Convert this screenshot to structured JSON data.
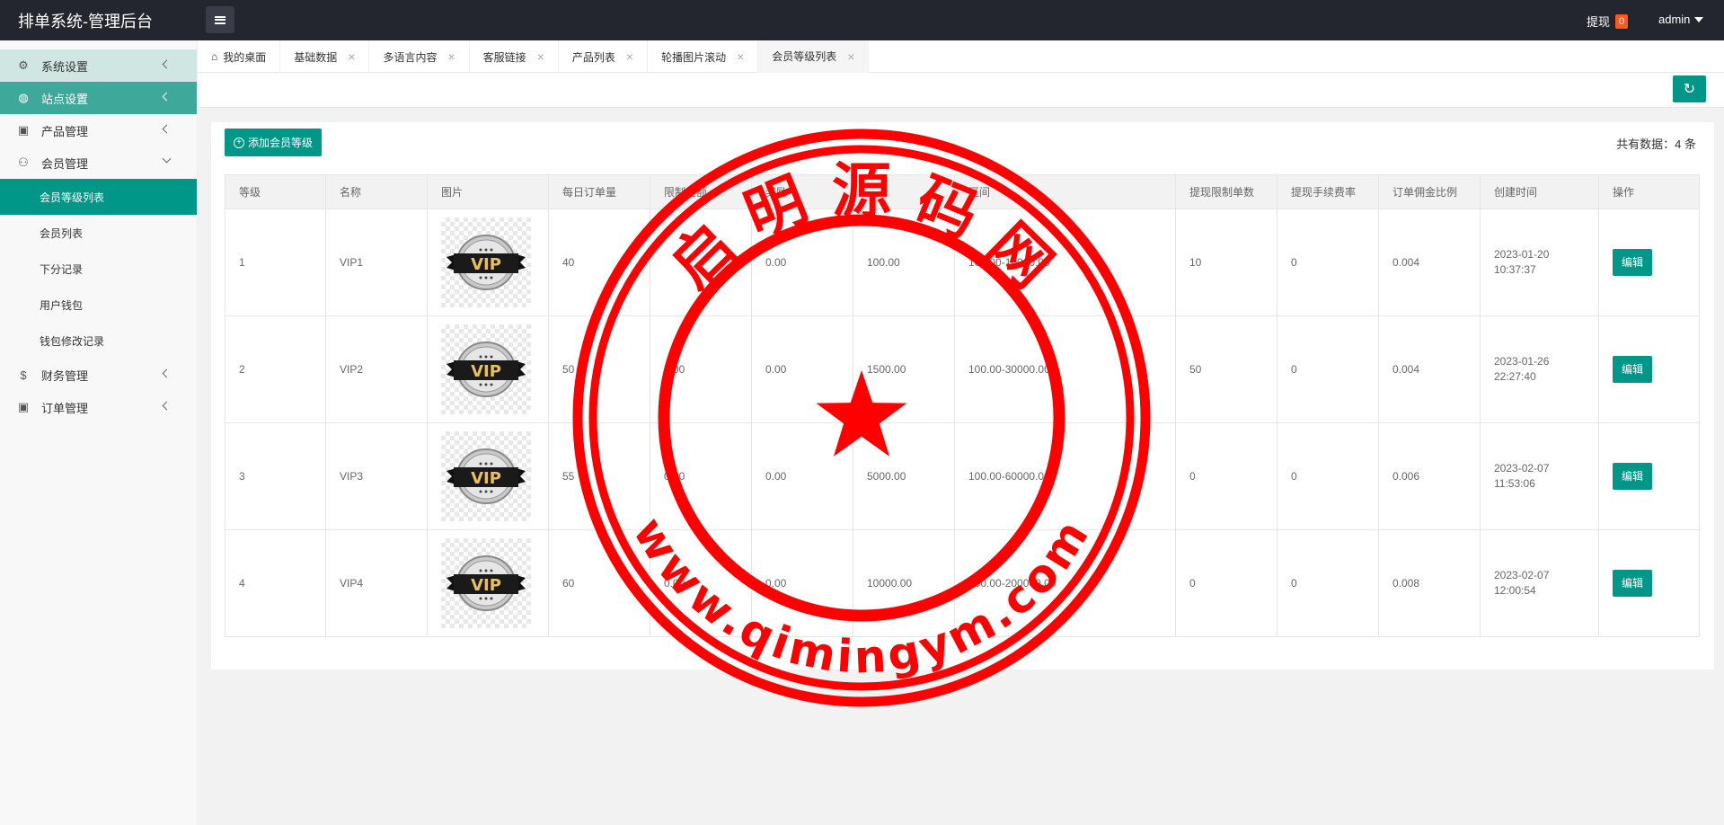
{
  "header": {
    "brand": "排单系统-管理后台",
    "withdraw_label": "提现",
    "withdraw_count": "0",
    "user": "admin"
  },
  "sidebar": {
    "items": [
      {
        "label": "系统设置",
        "icon": "gear-icon"
      },
      {
        "label": "站点设置",
        "icon": "globe-icon"
      },
      {
        "label": "产品管理",
        "icon": "box-icon"
      },
      {
        "label": "会员管理",
        "icon": "user-icon"
      }
    ],
    "member_sub": [
      "会员等级列表",
      "会员列表",
      "下分记录",
      "用户钱包",
      "钱包修改记录"
    ],
    "bottom_items": [
      {
        "label": "财务管理",
        "icon": "dollar-icon"
      },
      {
        "label": "订单管理",
        "icon": "box-icon"
      }
    ]
  },
  "tabs": [
    "我的桌面",
    "基础数据",
    "多语言内容",
    "客服链接",
    "产品列表",
    "轮播图片滚动",
    "会员等级列表"
  ],
  "toolbar": {
    "refresh_icon": "refresh-icon"
  },
  "card": {
    "add_button": "添加会员等级",
    "total_label": "共有数据：4 条"
  },
  "table": {
    "headers": [
      "等级",
      "名称",
      "图片",
      "每日订单量",
      "限制金额",
      "奖励",
      "",
      "区间",
      "提现限制单数",
      "提现手续费率",
      "订单佣金比例",
      "创建时间",
      "操作"
    ],
    "rows": [
      {
        "level": "1",
        "name": "VIP1",
        "orders": "40",
        "limit": "",
        "reward": "0.00",
        "col6": "100.00",
        "range": "100.00-10000.00",
        "wd_limit": "10",
        "fee": "0",
        "commission": "0.004",
        "created": "2023-01-20 10:37:37",
        "action": "编辑"
      },
      {
        "level": "2",
        "name": "VIP2",
        "orders": "50",
        "limit": "0.00",
        "reward": "0.00",
        "col6": "1500.00",
        "range": "100.00-30000.00",
        "wd_limit": "50",
        "fee": "0",
        "commission": "0.004",
        "created": "2023-01-26 22:27:40",
        "action": "编辑"
      },
      {
        "level": "3",
        "name": "VIP3",
        "orders": "55",
        "limit": "0.00",
        "reward": "0.00",
        "col6": "5000.00",
        "range": "100.00-60000.00",
        "wd_limit": "0",
        "fee": "0",
        "commission": "0.006",
        "created": "2023-02-07 11:53:06",
        "action": "编辑"
      },
      {
        "level": "4",
        "name": "VIP4",
        "orders": "60",
        "limit": "0.00",
        "reward": "0.00",
        "col6": "10000.00",
        "range": "100.00-200000.00",
        "wd_limit": "0",
        "fee": "0",
        "commission": "0.008",
        "created": "2023-02-07 12:00:54",
        "action": "编辑"
      }
    ],
    "vip_badge": "VIP"
  },
  "watermark": {
    "top_text": "启 明 源 码 网",
    "bottom_text": "www.qimingym.com",
    "color": "#ff0000"
  }
}
